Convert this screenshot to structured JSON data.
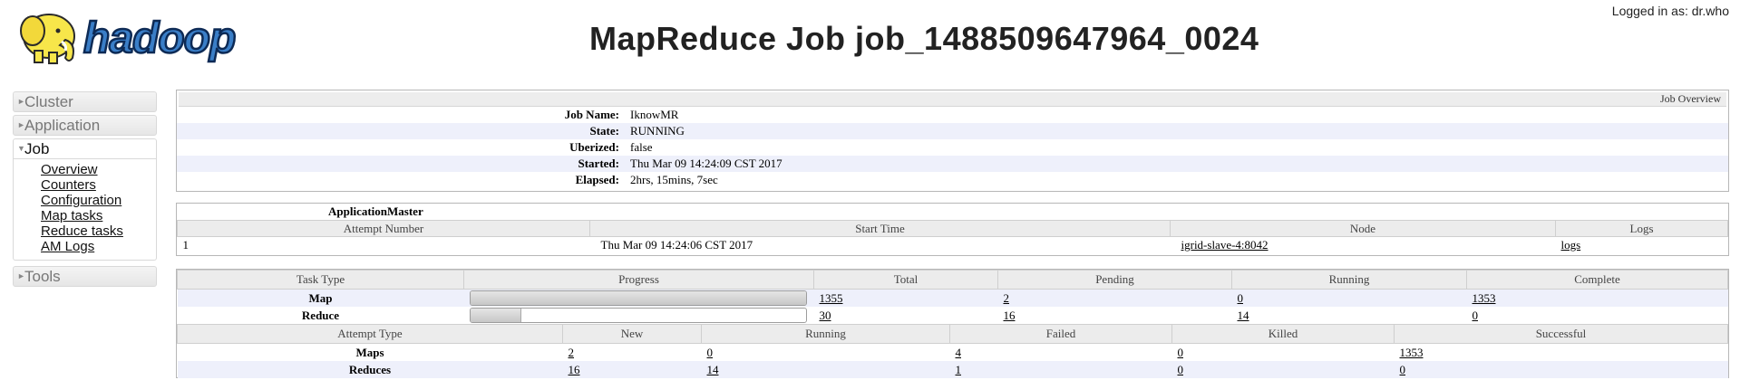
{
  "header": {
    "logo_text": "hadoop",
    "title": "MapReduce Job job_1488509647964_0024",
    "logged_in": "Logged in as: dr.who"
  },
  "nav": {
    "sections": [
      {
        "label": "Cluster",
        "expanded": false
      },
      {
        "label": "Application",
        "expanded": false
      },
      {
        "label": "Job",
        "expanded": true,
        "links": [
          "Overview",
          "Counters",
          "Configuration",
          "Map tasks",
          "Reduce tasks",
          "AM Logs"
        ]
      },
      {
        "label": "Tools",
        "expanded": false
      }
    ]
  },
  "job_overview": {
    "caption": "Job Overview",
    "rows": [
      {
        "key": "Job Name:",
        "value": "IknowMR"
      },
      {
        "key": "State:",
        "value": "RUNNING"
      },
      {
        "key": "Uberized:",
        "value": "false"
      },
      {
        "key": "Started:",
        "value": "Thu Mar 09 14:24:09 CST 2017"
      },
      {
        "key": "Elapsed:",
        "value": "2hrs, 15mins, 7sec"
      }
    ]
  },
  "application_master": {
    "title": "ApplicationMaster",
    "headers": [
      "Attempt Number",
      "Start Time",
      "Node",
      "Logs"
    ],
    "rows": [
      {
        "attempt": "1",
        "start_time": "Thu Mar 09 14:24:06 CST 2017",
        "node": "igrid-slave-4:8042",
        "logs": "logs"
      }
    ]
  },
  "tasks": {
    "headers": [
      "Task Type",
      "Progress",
      "Total",
      "Pending",
      "Running",
      "Complete"
    ],
    "rows": [
      {
        "type": "Map",
        "progress_percent": 100,
        "total": "1355",
        "pending": "2",
        "running": "0",
        "complete": "1353"
      },
      {
        "type": "Reduce",
        "progress_percent": 15,
        "total": "30",
        "pending": "16",
        "running": "14",
        "complete": "0"
      }
    ]
  },
  "attempts": {
    "headers": [
      "Attempt Type",
      "New",
      "Running",
      "Failed",
      "Killed",
      "Successful"
    ],
    "rows": [
      {
        "type": "Maps",
        "new": "2",
        "running": "0",
        "failed": "4",
        "killed": "0",
        "successful": "1353"
      },
      {
        "type": "Reduces",
        "new": "16",
        "running": "14",
        "failed": "1",
        "killed": "0",
        "successful": "0"
      }
    ]
  }
}
